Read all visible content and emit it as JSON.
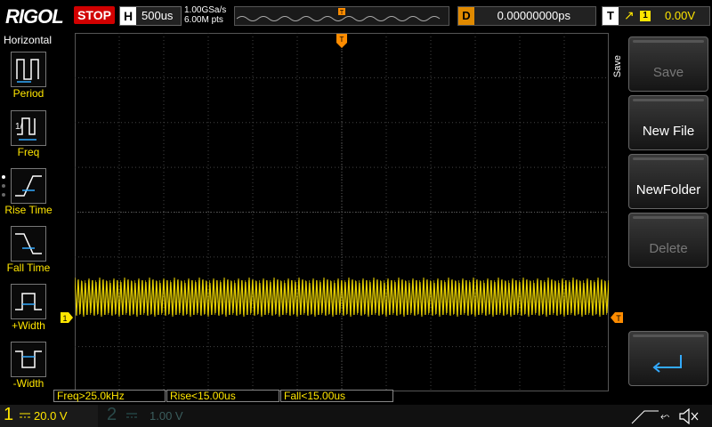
{
  "topbar": {
    "logo": "RIGOL",
    "run_state": "STOP",
    "horizontal_label": "H",
    "timebase": "500us",
    "sample_rate": "1.00GSa/s",
    "memory_depth": "6.00M pts",
    "delay_label": "D",
    "delay_value": "0.00000000ps",
    "trigger_label": "T",
    "trigger_channel": "1",
    "trigger_level": "0.00V"
  },
  "left_menu": {
    "title": "Horizontal",
    "items": [
      {
        "label": "Period",
        "icon": "period-icon"
      },
      {
        "label": "Freq",
        "icon": "frequency-icon"
      },
      {
        "label": "Rise Time",
        "icon": "rise-time-icon"
      },
      {
        "label": "Fall Time",
        "icon": "fall-time-icon"
      },
      {
        "label": "+Width",
        "icon": "positive-width-icon"
      },
      {
        "label": "-Width",
        "icon": "negative-width-icon"
      }
    ]
  },
  "right_menu": {
    "title": "Save",
    "buttons": [
      {
        "label": "Save",
        "enabled": false
      },
      {
        "label": "New File",
        "enabled": true
      },
      {
        "label": "NewFolder",
        "enabled": true
      },
      {
        "label": "Delete",
        "enabled": false
      }
    ],
    "return_icon": "return-arrow-icon"
  },
  "measurements": [
    {
      "text": "Freq>25.0kHz"
    },
    {
      "text": "Rise<15.00us"
    },
    {
      "text": "Fall<15.00us"
    }
  ],
  "channels": {
    "ch1": {
      "number": "1",
      "scale": "20.0 V",
      "color": "#ffe600"
    },
    "ch2": {
      "number": "2",
      "scale": "1.00 V",
      "color": "#2a5a5a"
    }
  },
  "colors": {
    "trace": "#ffe600",
    "trigger_marker": "#ff8c00",
    "stop": "#d10000"
  }
}
